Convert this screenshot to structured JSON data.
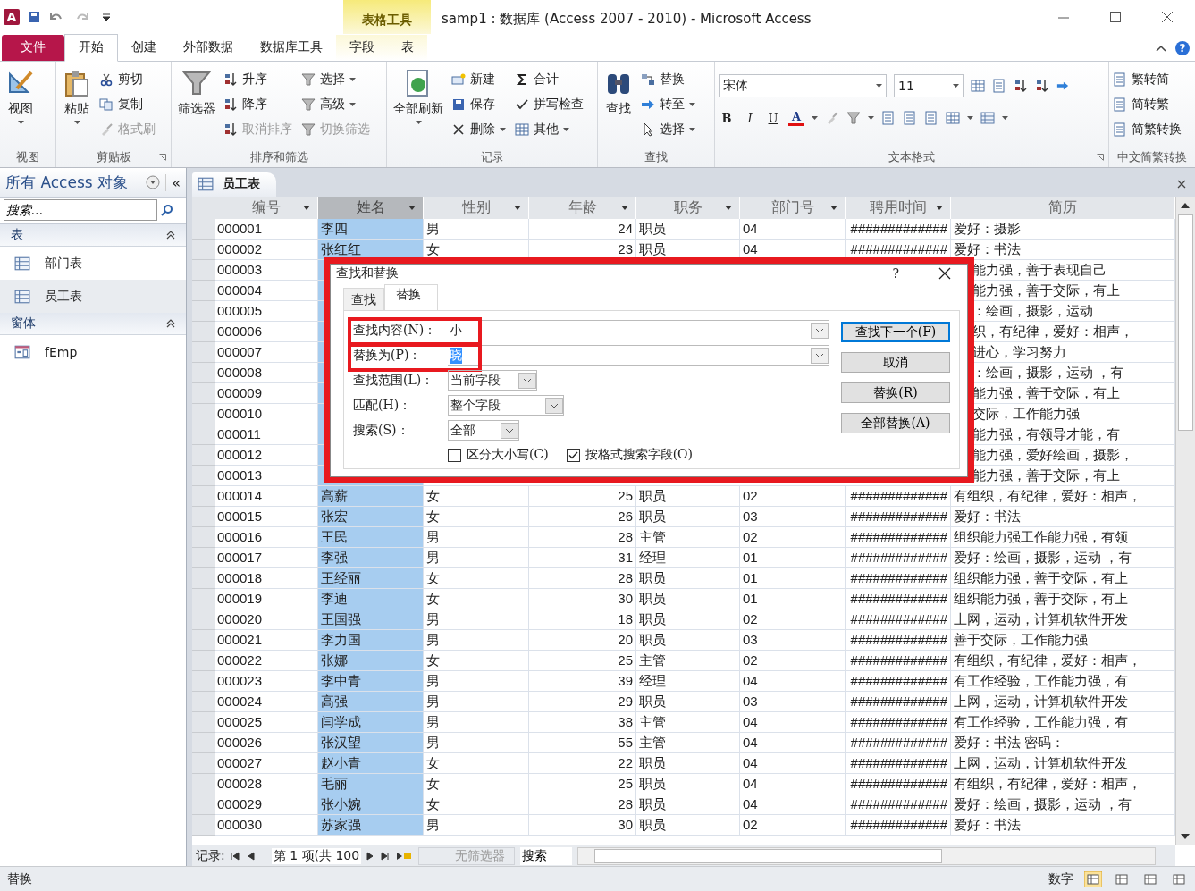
{
  "window": {
    "logo": "A",
    "title": "samp1 : 数据库 (Access 2007 - 2010)  -  Microsoft Access",
    "context_tab_group": "表格工具"
  },
  "ribbon_tabs": [
    {
      "label": "文件",
      "kind": "file",
      "selected": false
    },
    {
      "label": "开始",
      "kind": "normal",
      "selected": true
    },
    {
      "label": "创建",
      "kind": "normal",
      "selected": false
    },
    {
      "label": "外部数据",
      "kind": "normal",
      "selected": false
    },
    {
      "label": "数据库工具",
      "kind": "normal",
      "selected": false
    },
    {
      "label": "字段",
      "kind": "context",
      "selected": false
    },
    {
      "label": "表",
      "kind": "context",
      "selected": false
    }
  ],
  "help": "?",
  "ribbon_groups": [
    {
      "label": "视图",
      "launcher": false,
      "kind": "buttons",
      "items": [
        {
          "label": "视图",
          "kind": "large",
          "dropdown": true,
          "disabled": false
        }
      ]
    },
    {
      "label": "剪贴板",
      "launcher": true,
      "kind": "buttons",
      "items": [
        {
          "label": "粘贴",
          "kind": "large",
          "dropdown": true,
          "disabled": false
        },
        {
          "label": "剪切",
          "kind": "small",
          "dropdown": false,
          "disabled": false
        },
        {
          "label": "复制",
          "kind": "small",
          "dropdown": false,
          "disabled": false
        },
        {
          "label": "格式刷",
          "kind": "small",
          "dropdown": false,
          "disabled": true
        }
      ]
    },
    {
      "label": "排序和筛选",
      "launcher": false,
      "kind": "buttons",
      "items": [
        {
          "label": "筛选器",
          "kind": "large",
          "dropdown": false,
          "disabled": false
        },
        {
          "label": "升序",
          "kind": "small",
          "dropdown": false,
          "disabled": false
        },
        {
          "label": "降序",
          "kind": "small",
          "dropdown": false,
          "disabled": false
        },
        {
          "label": "取消排序",
          "kind": "small",
          "dropdown": false,
          "disabled": true
        },
        {
          "label": "选择",
          "kind": "small",
          "dropdown": true,
          "disabled": false
        },
        {
          "label": "高级",
          "kind": "small",
          "dropdown": true,
          "disabled": false
        },
        {
          "label": "切换筛选",
          "kind": "small",
          "dropdown": false,
          "disabled": true
        }
      ]
    },
    {
      "label": "记录",
      "launcher": false,
      "kind": "buttons",
      "items": [
        {
          "label": "全部刷新",
          "kind": "large",
          "dropdown": true,
          "disabled": false
        },
        {
          "label": "新建",
          "kind": "small",
          "dropdown": false,
          "disabled": false
        },
        {
          "label": "保存",
          "kind": "small",
          "dropdown": false,
          "disabled": false
        },
        {
          "label": "删除",
          "kind": "small",
          "dropdown": true,
          "disabled": false
        },
        {
          "label": "合计",
          "kind": "small",
          "dropdown": false,
          "disabled": false
        },
        {
          "label": "拼写检查",
          "kind": "small",
          "dropdown": false,
          "disabled": false
        },
        {
          "label": "其他",
          "kind": "small",
          "dropdown": true,
          "disabled": false
        }
      ]
    },
    {
      "label": "查找",
      "launcher": false,
      "kind": "buttons",
      "items": [
        {
          "label": "查找",
          "kind": "large",
          "dropdown": false,
          "disabled": false
        },
        {
          "label": "替换",
          "kind": "small",
          "dropdown": false,
          "disabled": false
        },
        {
          "label": "转至",
          "kind": "small",
          "dropdown": true,
          "disabled": false
        },
        {
          "label": "选择",
          "kind": "small",
          "dropdown": true,
          "disabled": false
        }
      ]
    },
    {
      "label": "文本格式",
      "launcher": true,
      "kind": "format",
      "font": "宋体",
      "size": "11",
      "bold": "B",
      "italic": "I",
      "underline": "U",
      "font_color": "A"
    },
    {
      "label": "中文简繁转换",
      "launcher": false,
      "kind": "buttons",
      "items": [
        {
          "label": "繁转简",
          "kind": "small",
          "dropdown": false,
          "disabled": false
        },
        {
          "label": "简转繁",
          "kind": "small",
          "dropdown": false,
          "disabled": false
        },
        {
          "label": "简繁转换",
          "kind": "small",
          "dropdown": false,
          "disabled": false
        }
      ]
    }
  ],
  "nav_pane": {
    "title": "所有 Access 对象",
    "collapse": "«",
    "search": {
      "placeholder": "搜索..."
    },
    "sections": [
      {
        "label": "表",
        "items": [
          {
            "label": "部门表",
            "kind": "table",
            "selected": false
          },
          {
            "label": "员工表",
            "kind": "table",
            "selected": true
          }
        ]
      },
      {
        "label": "窗体",
        "items": [
          {
            "label": "fEmp",
            "kind": "form",
            "selected": false
          }
        ]
      }
    ]
  },
  "document_tab": {
    "label": "员工表"
  },
  "table": {
    "columns": [
      {
        "label": "编号",
        "filter": true,
        "selected": false
      },
      {
        "label": "姓名",
        "filter": true,
        "selected": true
      },
      {
        "label": "性别",
        "filter": true,
        "selected": false
      },
      {
        "label": "年龄",
        "filter": true,
        "selected": false
      },
      {
        "label": "职务",
        "filter": true,
        "selected": false
      },
      {
        "label": "部门号",
        "filter": true,
        "selected": false
      },
      {
        "label": "聘用时间",
        "filter": true,
        "selected": false
      },
      {
        "label": "简历",
        "filter": false,
        "selected": false
      }
    ],
    "rows": [
      {
        "kind": "full",
        "cells": [
          "000001",
          "李四",
          "男",
          "24",
          "职员",
          "04",
          "#############",
          "爱好：摄影"
        ]
      },
      {
        "kind": "full",
        "cells": [
          "000002",
          "张红红",
          "女",
          "23",
          "职员",
          "04",
          "#############",
          "爱好：书法"
        ]
      },
      {
        "kind": "partial",
        "cells": [
          "000003",
          "能力强，善于表现自己"
        ]
      },
      {
        "kind": "partial",
        "cells": [
          "000004",
          "能力强，善于交际，有上"
        ]
      },
      {
        "kind": "partial",
        "cells": [
          "000005",
          "：绘画，摄影，运动"
        ]
      },
      {
        "kind": "partial",
        "cells": [
          "000006",
          "织，有纪律，爱好：相声，"
        ]
      },
      {
        "kind": "partial",
        "cells": [
          "000007",
          "进心，学习努力"
        ]
      },
      {
        "kind": "partial",
        "cells": [
          "000008",
          "：绘画，摄影，运动 ，有"
        ]
      },
      {
        "kind": "partial",
        "cells": [
          "000009",
          "能力强，善于交际，有上"
        ]
      },
      {
        "kind": "partial",
        "cells": [
          "000010",
          "交际，工作能力强"
        ]
      },
      {
        "kind": "partial",
        "cells": [
          "000011",
          "能力强，有领导才能，有"
        ]
      },
      {
        "kind": "partial",
        "cells": [
          "000012",
          "能力强，爱好绘画，摄影，"
        ]
      },
      {
        "kind": "partial",
        "cells": [
          "000013",
          "能力强，善于交际，有上"
        ]
      },
      {
        "kind": "full",
        "cells": [
          "000014",
          "高薪",
          "女",
          "25",
          "职员",
          "02",
          "#############",
          "有组织，有纪律，爱好：相声，"
        ]
      },
      {
        "kind": "full",
        "cells": [
          "000015",
          "张宏",
          "女",
          "26",
          "职员",
          "03",
          "#############",
          "爱好：书法"
        ]
      },
      {
        "kind": "full",
        "cells": [
          "000016",
          "王民",
          "男",
          "28",
          "主管",
          "02",
          "#############",
          "组织能力强工作能力强，有领"
        ]
      },
      {
        "kind": "full",
        "cells": [
          "000017",
          "李强",
          "男",
          "31",
          "经理",
          "01",
          "#############",
          "爱好：绘画，摄影，运动 ，有"
        ]
      },
      {
        "kind": "full",
        "cells": [
          "000018",
          "王经丽",
          "女",
          "28",
          "职员",
          "01",
          "#############",
          "组织能力强，善于交际，有上"
        ]
      },
      {
        "kind": "full",
        "cells": [
          "000019",
          "李迪",
          "女",
          "30",
          "职员",
          "01",
          "#############",
          "组织能力强，善于交际，有上"
        ]
      },
      {
        "kind": "full",
        "cells": [
          "000020",
          "王国强",
          "男",
          "18",
          "职员",
          "02",
          "#############",
          "上网，运动，计算机软件开发"
        ]
      },
      {
        "kind": "full",
        "cells": [
          "000021",
          "李力国",
          "男",
          "20",
          "职员",
          "03",
          "#############",
          "善于交际，工作能力强"
        ]
      },
      {
        "kind": "full",
        "cells": [
          "000022",
          "张娜",
          "女",
          "25",
          "主管",
          "02",
          "#############",
          "有组织，有纪律，爱好：相声，"
        ]
      },
      {
        "kind": "full",
        "cells": [
          "000023",
          "李中青",
          "男",
          "39",
          "经理",
          "04",
          "#############",
          "有工作经验，工作能力强，有"
        ]
      },
      {
        "kind": "full",
        "cells": [
          "000024",
          "高强",
          "男",
          "29",
          "职员",
          "03",
          "#############",
          "上网，运动，计算机软件开发"
        ]
      },
      {
        "kind": "full",
        "cells": [
          "000025",
          "闫学成",
          "男",
          "38",
          "主管",
          "04",
          "#############",
          "有工作经验，工作能力强，有"
        ]
      },
      {
        "kind": "full",
        "cells": [
          "000026",
          "张汉望",
          "男",
          "55",
          "主管",
          "04",
          "#############",
          "爱好：书法 密码："
        ]
      },
      {
        "kind": "full",
        "cells": [
          "000027",
          "赵小青",
          "女",
          "22",
          "职员",
          "04",
          "#############",
          "上网，运动，计算机软件开发"
        ]
      },
      {
        "kind": "full",
        "cells": [
          "000028",
          "毛丽",
          "女",
          "25",
          "职员",
          "04",
          "#############",
          "有组织，有纪律，爱好：相声，"
        ]
      },
      {
        "kind": "full",
        "cells": [
          "000029",
          "张小婉",
          "女",
          "28",
          "职员",
          "04",
          "#############",
          "爱好：绘画，摄影，运动 ，有"
        ]
      },
      {
        "kind": "full",
        "cells": [
          "000030",
          "苏家强",
          "男",
          "30",
          "职员",
          "02",
          "#############",
          "爱好：书法"
        ]
      }
    ]
  },
  "record_nav": {
    "label": "记录:",
    "position": "第 1 项(共 100",
    "filter": "无筛选器",
    "filter_disabled": true,
    "search": "搜索"
  },
  "dialog": {
    "title": "查找和替换",
    "help": "?",
    "highlighted": true,
    "tabs": [
      {
        "label": "查找",
        "selected": false
      },
      {
        "label": "替换",
        "selected": true
      }
    ],
    "fields": [
      {
        "label": "查找内容(N)：",
        "value": "小",
        "value_selected": false,
        "highlighted": true
      },
      {
        "label": "替换为(P)：",
        "value": "晓",
        "value_selected": true,
        "highlighted": true
      }
    ],
    "options": [
      {
        "label": "查找范围(L)：",
        "value": "当前字段"
      },
      {
        "label": "匹配(H)：",
        "value": "整个字段"
      },
      {
        "label": "搜索(S)：",
        "value": "全部"
      }
    ],
    "checkboxes": [
      {
        "label": "区分大小写(C)",
        "checked": false
      },
      {
        "label": "按格式搜索字段(O)",
        "checked": true
      }
    ],
    "buttons": [
      {
        "label": "查找下一个(F)",
        "default": true
      },
      {
        "label": "取消",
        "default": false
      },
      {
        "label": "替换(R)",
        "default": false
      },
      {
        "label": "全部替换(A)",
        "default": false
      }
    ]
  },
  "status_bar": {
    "message": "替换",
    "mode": "数字",
    "views": [
      {
        "selected": true
      },
      {
        "selected": false
      },
      {
        "selected": false
      },
      {
        "selected": false
      }
    ]
  }
}
